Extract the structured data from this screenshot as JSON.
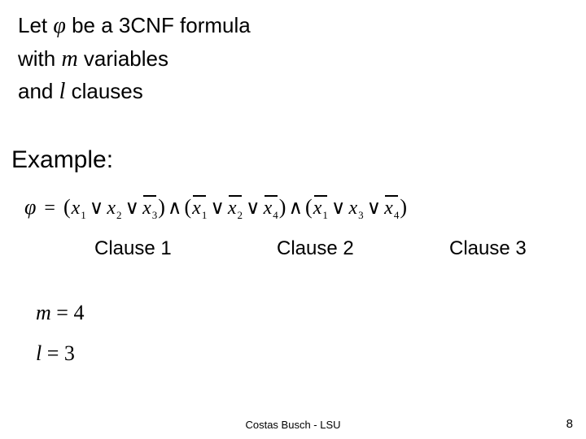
{
  "intro": {
    "line1_a": "Let ",
    "line1_var": "φ",
    "line1_b": " be a 3CNF formula",
    "line2_a": "with ",
    "line2_var": "m",
    "line2_b": " variables",
    "line3_a": "and ",
    "line3_var": "l",
    "line3_b": " clauses"
  },
  "example_heading": "Example:",
  "formula": {
    "phi": "φ",
    "eq": "=",
    "or": "∨",
    "and": "∧",
    "lp": "(",
    "rp": ")",
    "clauses": [
      {
        "lits": [
          {
            "v": "x",
            "s": "1",
            "neg": false
          },
          {
            "v": "x",
            "s": "2",
            "neg": false
          },
          {
            "v": "x",
            "s": "3",
            "neg": true
          }
        ]
      },
      {
        "lits": [
          {
            "v": "x",
            "s": "1",
            "neg": true
          },
          {
            "v": "x",
            "s": "2",
            "neg": true
          },
          {
            "v": "x",
            "s": "4",
            "neg": true
          }
        ]
      },
      {
        "lits": [
          {
            "v": "x",
            "s": "1",
            "neg": true
          },
          {
            "v": "x",
            "s": "3",
            "neg": false
          },
          {
            "v": "x",
            "s": "4",
            "neg": true
          }
        ]
      }
    ]
  },
  "clause_labels": [
    "Clause 1",
    "Clause 2",
    "Clause 3"
  ],
  "equations": {
    "m_var": "m",
    "m_val": "4",
    "l_var": "l",
    "l_val": "3",
    "eq": "="
  },
  "footer": "Costas Busch - LSU",
  "page": "8"
}
